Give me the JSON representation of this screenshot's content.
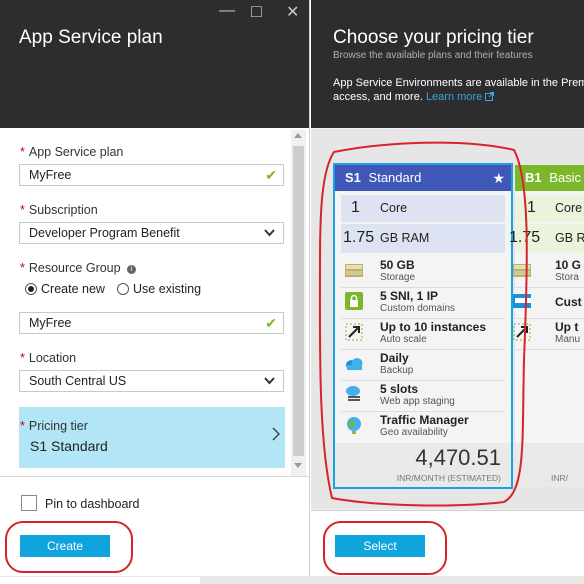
{
  "left": {
    "title": "App Service plan",
    "window_controls": {
      "minimize": "—",
      "maximize": "□",
      "close": "✕"
    },
    "plan_label": "App Service plan",
    "plan_value": "MyFree",
    "subscription_label": "Subscription",
    "subscription_value": "Developer Program Benefit",
    "resource_group_label": "Resource Group",
    "rg_create_new": "Create new",
    "rg_use_existing": "Use existing",
    "rg_value": "MyFree",
    "location_label": "Location",
    "location_value": "South Central US",
    "pricing_label": "Pricing tier",
    "pricing_value": "S1 Standard",
    "pin_label": "Pin to dashboard",
    "create_button": "Create",
    "required_mark": "*",
    "check_glyph": "✔",
    "chevron_glyph": "⌵",
    "info_glyph": "i"
  },
  "right": {
    "title": "Choose your pricing tier",
    "subtitle": "Browse the available plans and their features",
    "note": "App Service Environments are available in the Prem",
    "note_line2": "access, and more.",
    "learn_more": "Learn more",
    "select_button": "Select"
  },
  "cards": [
    {
      "tier": "S1",
      "name": "Standard",
      "star": "★",
      "cores_num": "1",
      "cores_label": "Core",
      "ram_num": "1.75",
      "ram_label": "GB RAM",
      "features": [
        {
          "title": "50 GB",
          "sub": "Storage",
          "icon": "storage-icon"
        },
        {
          "title": "5 SNI, 1 IP",
          "sub": "Custom domains",
          "icon": "lock-icon"
        },
        {
          "title": "Up to 10 instances",
          "sub": "Auto scale",
          "icon": "autoscale-icon"
        },
        {
          "title": "Daily",
          "sub": "Backup",
          "icon": "cloud-backup-icon"
        },
        {
          "title": "5 slots",
          "sub": "Web app staging",
          "icon": "slots-icon"
        },
        {
          "title": "Traffic Manager",
          "sub": "Geo availability",
          "icon": "globe-icon"
        }
      ],
      "price": "4,470.51",
      "price_unit": "INR/MONTH (ESTIMATED)"
    },
    {
      "tier": "B1",
      "name": "Basic",
      "cores_num": "1",
      "cores_label": "Core",
      "ram_num": "1.75",
      "ram_label": "GB R",
      "features": [
        {
          "title": "10 G",
          "sub": "Stora",
          "icon": "storage-icon"
        },
        {
          "title": "Cust",
          "sub": "",
          "icon": "www-icon"
        },
        {
          "title": "Up t",
          "sub": "Manu",
          "icon": "autoscale-icon"
        }
      ],
      "price_unit": "INR/"
    }
  ],
  "colors": {
    "accent": "#10a4dc",
    "header": "#2d2d30",
    "standard": "#3f57b7",
    "basic": "#7ab829",
    "selected": "#b2e6f7",
    "annotation": "#d8232a"
  }
}
